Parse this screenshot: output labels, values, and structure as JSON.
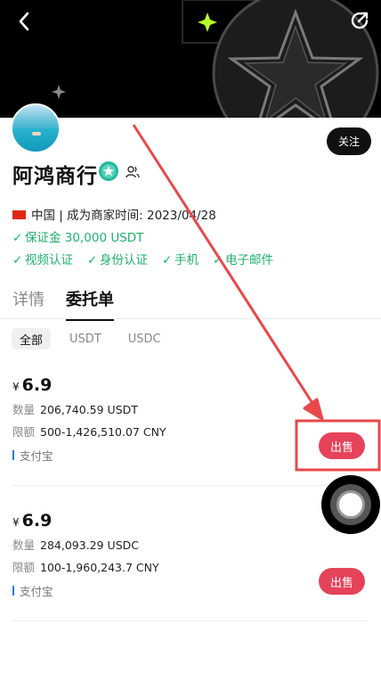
{
  "header": {
    "back": "back-icon",
    "share": "share-icon"
  },
  "profile": {
    "name": "阿鸿商行",
    "follow_label": "关注",
    "country": "中国",
    "merchant_since": "| 成为商家时间: 2023/04/28",
    "deposit": "保证金 30,000 USDT",
    "verifications": [
      "视频认证",
      "身份认证",
      "手机",
      "电子邮件"
    ]
  },
  "tabs": [
    "详情",
    "委托单"
  ],
  "active_tab": "委托单",
  "filters": [
    "全部",
    "USDT",
    "USDC"
  ],
  "orders": [
    {
      "currency_symbol": "¥",
      "price": "6.9",
      "qty_label": "数量",
      "qty": "206,740.59 USDT",
      "limit_label": "限额",
      "limit": "500-1,426,510.07 CNY",
      "payment": "支付宝",
      "action": "出售"
    },
    {
      "currency_symbol": "¥",
      "price": "6.9",
      "qty_label": "数量",
      "qty": "284,093.29 USDC",
      "limit_label": "限额",
      "limit": "100-1,960,243.7 CNY",
      "payment": "支付宝",
      "action": "出售"
    }
  ],
  "colors": {
    "accent_green": "#1fb16d",
    "sell": "#e5435a",
    "annotation": "#e8484a"
  }
}
